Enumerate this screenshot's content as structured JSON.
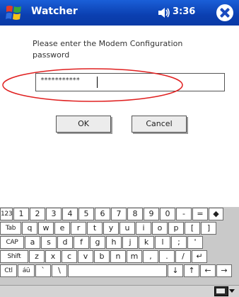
{
  "titlebar": {
    "app_title": "Watcher",
    "time": "3:36",
    "start_icon": "windows-flag-icon",
    "volume_icon": "speaker-icon",
    "close_icon": "close-icon"
  },
  "dialog": {
    "prompt": "Please enter the Modem Configuration password",
    "password_value": "***********",
    "ok_label": "OK",
    "cancel_label": "Cancel"
  },
  "keyboard": {
    "rows": [
      [
        "123",
        "1",
        "2",
        "3",
        "4",
        "5",
        "6",
        "7",
        "8",
        "9",
        "0",
        "-",
        "=",
        "◆"
      ],
      [
        "Tab",
        "q",
        "w",
        "e",
        "r",
        "t",
        "y",
        "u",
        "i",
        "o",
        "p",
        "[",
        "]"
      ],
      [
        "CAP",
        "a",
        "s",
        "d",
        "f",
        "g",
        "h",
        "j",
        "k",
        "l",
        ";",
        "'"
      ],
      [
        "Shift",
        "z",
        "x",
        "c",
        "v",
        "b",
        "n",
        "m",
        ",",
        ".",
        "/",
        "↵"
      ],
      [
        "Ctl",
        "áü",
        "`",
        "\\",
        "",
        "↓",
        "↑",
        "←",
        "→"
      ]
    ]
  },
  "menubar": {
    "input_icon": "keyboard-input-icon",
    "arrow_icon": "chevron-up-icon"
  },
  "colors": {
    "titlebar": "#0b3fb0",
    "annotation": "#e02020",
    "keyboard_bg": "#c9c9c9"
  }
}
